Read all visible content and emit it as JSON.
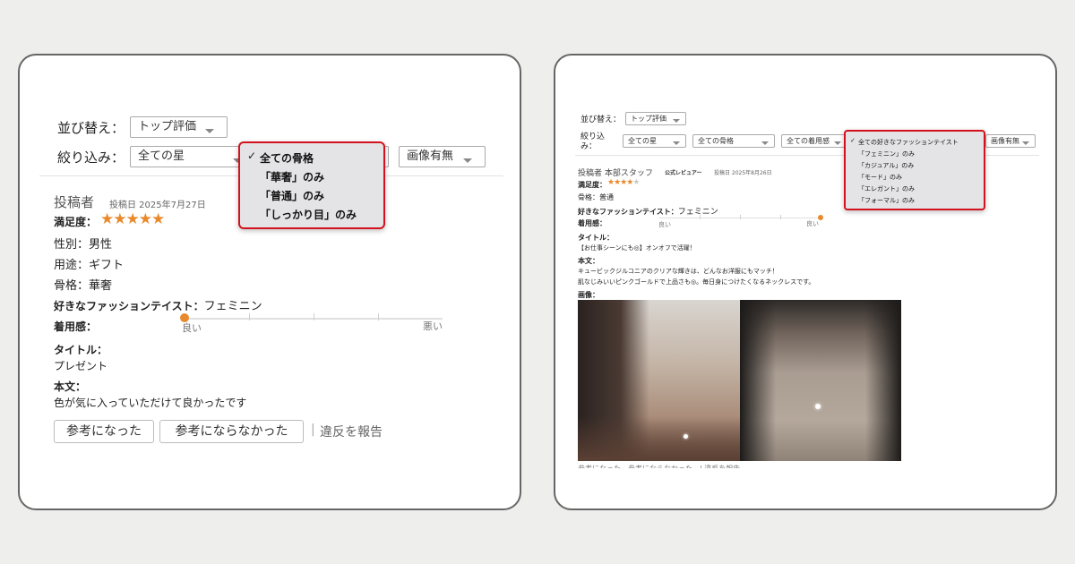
{
  "left": {
    "sort": {
      "label": "並び替え：",
      "value": "トップ評価"
    },
    "filter": {
      "label": "絞り込み：",
      "stars_value": "全ての星",
      "image_value": "画像有無"
    },
    "dropdown": {
      "items": [
        {
          "label": "全ての骨格",
          "selected": true
        },
        {
          "label": "「華奢」のみ",
          "selected": false
        },
        {
          "label": "「普通」のみ",
          "selected": false
        },
        {
          "label": "「しっかり目」のみ",
          "selected": false
        }
      ]
    },
    "review": {
      "poster_label": "投稿者",
      "post_date": "投稿日 2025年7月27日",
      "satisfaction_label": "満足度：",
      "rating": 5,
      "gender": "性別：男性",
      "purpose": "用途：ギフト",
      "frame": "骨格：華奢",
      "taste_label": "好きなファッションテイスト：",
      "taste_value": "フェミニン",
      "fit_label": "着用感：",
      "fit_good": "良い",
      "fit_bad": "悪い",
      "fit_level": 0.0,
      "title_label": "タイトル：",
      "title_value": "プレゼント",
      "body_label": "本文：",
      "body_value": "色が気に入っていただけて良かったです",
      "helpful": "参考になった",
      "not_helpful": "参考にならなかった",
      "separator": "|",
      "report": "違反を報告"
    }
  },
  "right": {
    "sort": {
      "label": "並び替え：",
      "value": "トップ評価"
    },
    "filter": {
      "label_line1": "絞り込",
      "label_line2": "み：",
      "stars_value": "全ての星",
      "frame_value": "全ての骨格",
      "fit_value": "全ての着用感",
      "image_value": "画像有無"
    },
    "dropdown": {
      "items": [
        {
          "label": "全ての好きなファッションテイスト",
          "selected": true
        },
        {
          "label": "「フェミニン」のみ",
          "selected": false
        },
        {
          "label": "「カジュアル」のみ",
          "selected": false
        },
        {
          "label": "「モード」のみ",
          "selected": false
        },
        {
          "label": "「エレガント」のみ",
          "selected": false
        },
        {
          "label": "「フォーマル」のみ",
          "selected": false
        }
      ]
    },
    "review": {
      "poster": "投稿者 本部スタッフ",
      "badge": "公式レビュアー",
      "post_date": "投稿日 2025年8月26日",
      "satisfaction_label": "満足度：",
      "rating": 4,
      "frame": "骨格：普通",
      "taste_label": "好きなファッションテイスト：",
      "taste_value": "フェミニン",
      "fit_label": "着用感：",
      "fit_good": "良い",
      "fit_bad": "良い",
      "fit_level": 1.0,
      "title_label": "タイトル：",
      "title_value": "【お仕事シーンにも◎】オンオフで活躍！",
      "body_label": "本文：",
      "body_line1": "キュービックジルコニアのクリアな輝きは、どんなお洋服にもマッチ！",
      "body_line2": "肌なじみいいピンクゴールドで上品さも◎。毎日身につけたくなるネックレスです。",
      "image_label": "画像：",
      "bottom_partial": "参考になった　参考にならなかった　| 違反を報告"
    }
  },
  "colors": {
    "accent_orange": "#e8892c",
    "highlight_red": "#d3121d"
  }
}
